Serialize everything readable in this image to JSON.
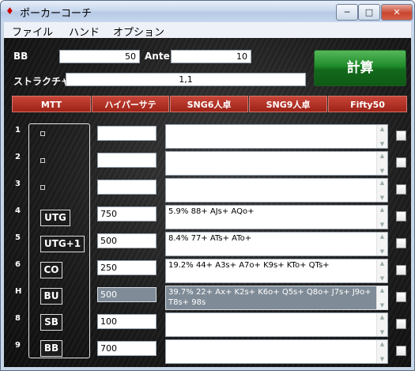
{
  "window": {
    "title": "ポーカーコーチ",
    "app_icon": "poker-icon",
    "minimize": "─",
    "maximize": "□",
    "close": "✕"
  },
  "menu": [
    "ファイル",
    "ハンド",
    "オプション"
  ],
  "form": {
    "bb_label": "BB",
    "bb_value": "50",
    "ante_label": "Ante",
    "ante_value": "10",
    "structure_label": "ストラクチャ",
    "structure_value": "1,1",
    "calc_button": "計算"
  },
  "tabs": [
    "MTT",
    "ハイパーサテ",
    "SNG6人卓",
    "SNG9人卓",
    "Fifty50"
  ],
  "rows": [
    {
      "num": "1",
      "position": "",
      "value": "",
      "range": ""
    },
    {
      "num": "2",
      "position": "",
      "value": "",
      "range": ""
    },
    {
      "num": "3",
      "position": "",
      "value": "",
      "range": ""
    },
    {
      "num": "4",
      "position": "UTG",
      "value": "750",
      "range": "5.9% 88+ AJs+ AQo+"
    },
    {
      "num": "5",
      "position": "UTG+1",
      "value": "500",
      "range": "8.4% 77+ ATs+ ATo+"
    },
    {
      "num": "6",
      "position": "CO",
      "value": "250",
      "range": "19.2% 44+ A3s+ A7o+ K9s+ KTo+ QTs+"
    },
    {
      "num": "H",
      "position": "BU",
      "value": "500",
      "range": "39.7% 22+ Ax+ K2s+ K6o+ Q5s+ Q8o+ J7s+ J9o+ T8s+ 98s",
      "selected": true
    },
    {
      "num": "8",
      "position": "SB",
      "value": "100",
      "range": ""
    },
    {
      "num": "9",
      "position": "BB",
      "value": "700",
      "range": ""
    }
  ],
  "colors": {
    "tab_red": "#b03325",
    "calc_green": "#1f8a2a",
    "background": "#1c1c1c"
  }
}
